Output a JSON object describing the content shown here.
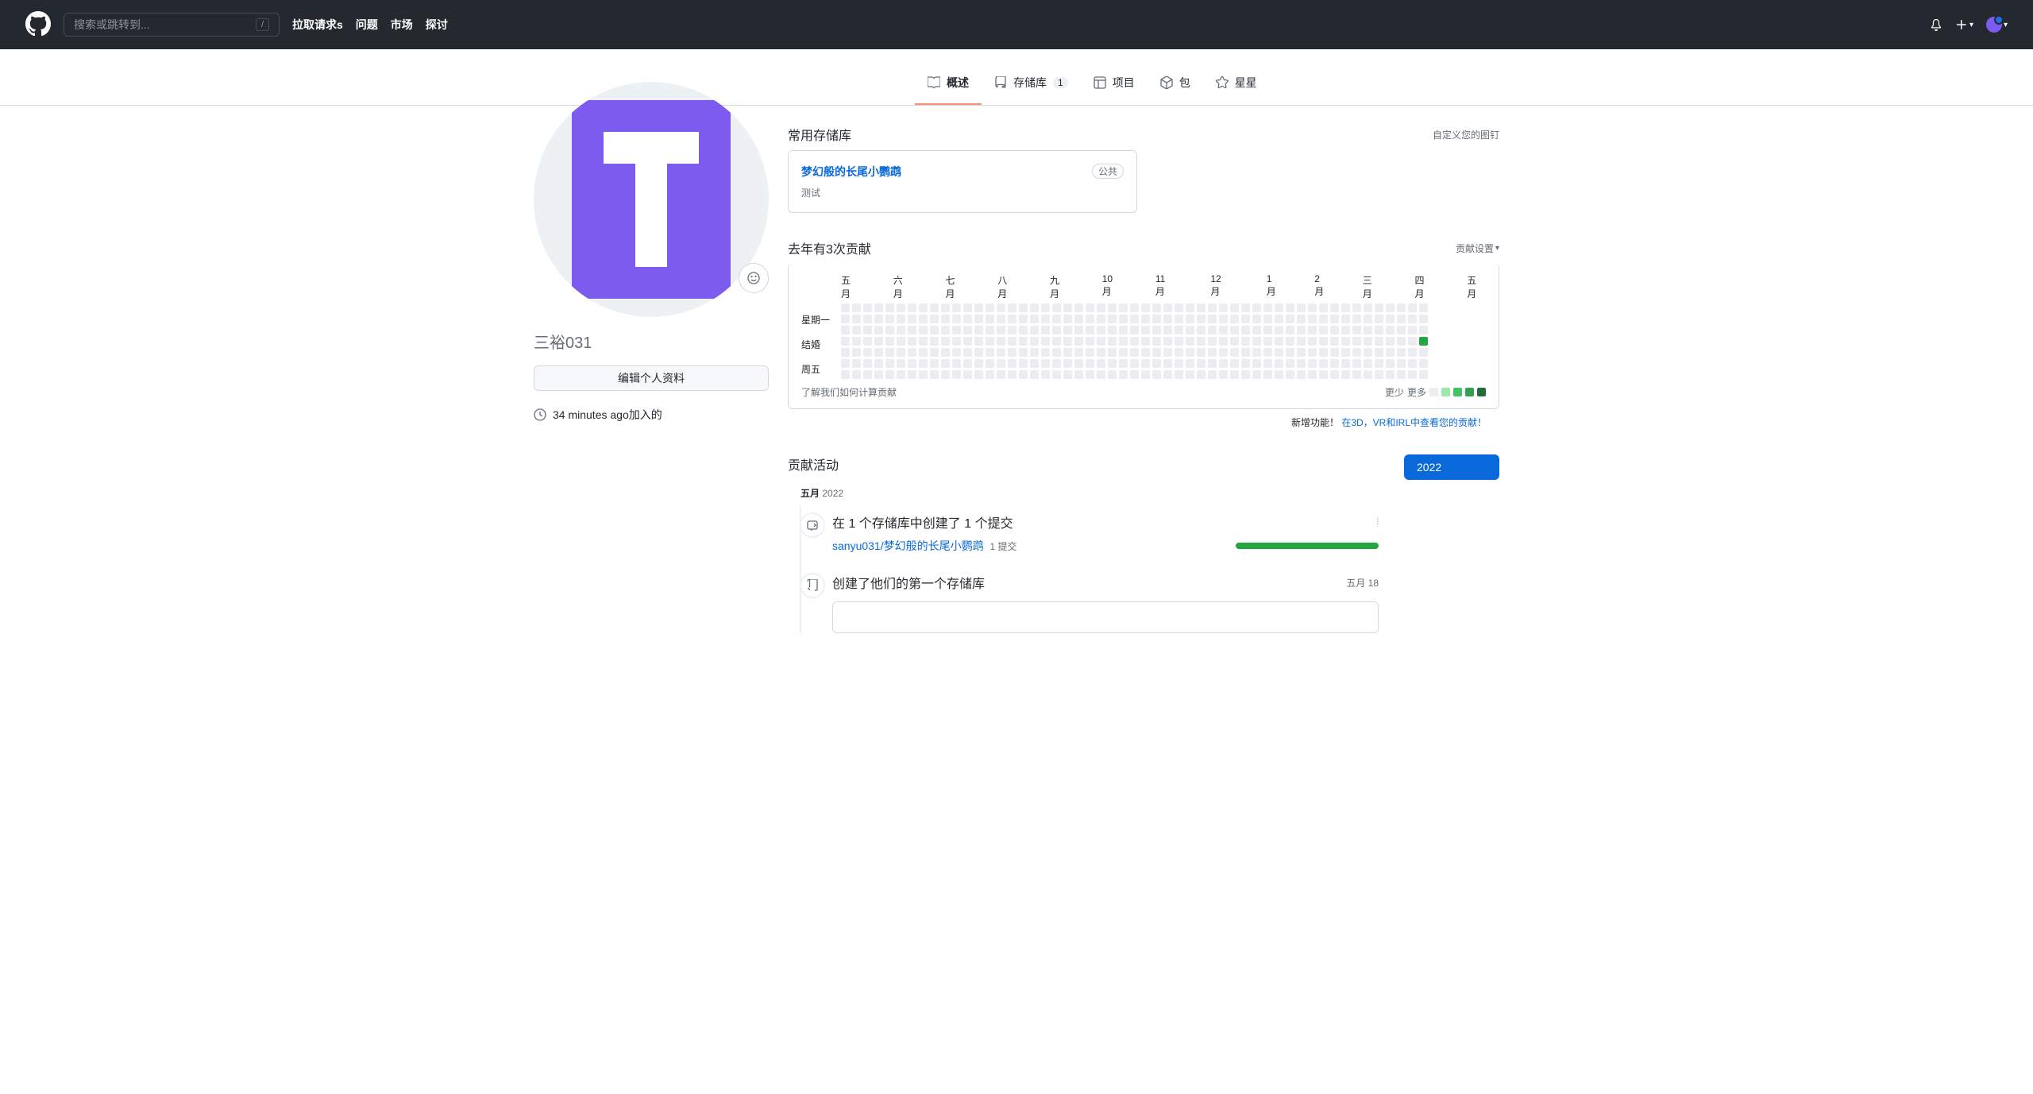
{
  "header": {
    "search_placeholder": "搜索或跳转到...",
    "nav": {
      "pulls": "拉取请求s",
      "issues": "问题",
      "market": "市场",
      "discuss": "探讨"
    }
  },
  "tabs": {
    "overview": "概述",
    "repos": "存储库",
    "repos_count": "1",
    "projects": "项目",
    "packages": "包",
    "stars": "星星"
  },
  "sidebar": {
    "username": "三裕031",
    "edit_profile": "编辑个人资料",
    "joined": "34 minutes ago加入的"
  },
  "popular": {
    "title": "常用存储库",
    "customize": "自定义您的图钉",
    "repo_name": "梦幻般的长尾小鹦鹉",
    "visibility": "公共",
    "desc": "测试"
  },
  "contrib": {
    "title": "去年有3次贡献",
    "settings": "贡献设置",
    "months": [
      "五月",
      "六月",
      "七月",
      "八月",
      "九月",
      "10月",
      "11 月",
      "12 月",
      "1月",
      "2月",
      "三月",
      "四月",
      "五月"
    ],
    "days": [
      "星期一",
      "结婚",
      "周五"
    ],
    "learn": "了解我们如何计算贡献",
    "less": "更少",
    "more": "更多",
    "new_feature_prefix": "新增功能！",
    "new_feature_link": "在3D，VR和IRL中查看您的贡献！"
  },
  "activity": {
    "title": "贡献活动",
    "year": "2022",
    "month_label": "五月",
    "year_label": "2022",
    "commit_title": "在 1 个存储库中创建了 1 个提交",
    "commit_repo": "sanyu031/梦幻般的长尾小鹦鹉",
    "commit_count": "1 提交",
    "first_repo_title": "创建了他们的第一个存储库",
    "first_repo_date": "五月 18"
  },
  "chart_data": {
    "type": "heatmap",
    "title": "去年有3次贡献",
    "weeks": 53,
    "days_per_week": 7,
    "total_contributions": 3,
    "contribution_cells": [
      {
        "week": 52,
        "day": 3,
        "level": 4
      }
    ],
    "legend_levels": [
      0,
      1,
      2,
      3,
      4
    ]
  }
}
